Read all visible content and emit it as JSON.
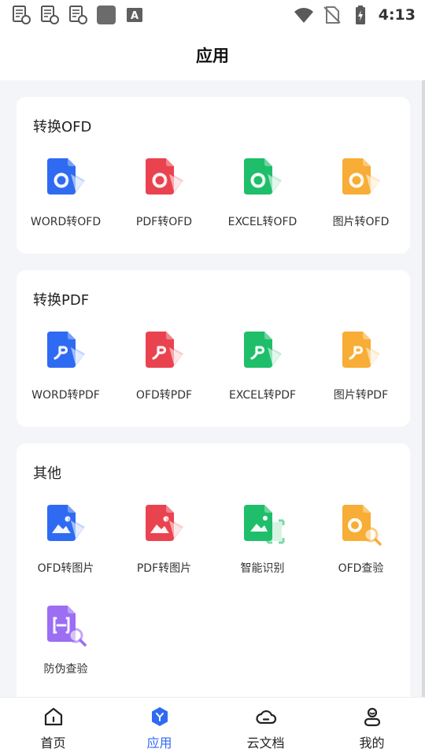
{
  "status_bar": {
    "time": "4:13",
    "badge_letter": "A"
  },
  "header": {
    "title": "应用"
  },
  "sections": [
    {
      "title": "转换OFD",
      "items": [
        {
          "label": "WORD转OFD",
          "glyph": "O",
          "color": "#2f6bf2",
          "icon": "word-to-ofd-icon"
        },
        {
          "label": "PDF转OFD",
          "glyph": "O",
          "color": "#ea4350",
          "icon": "pdf-to-ofd-icon"
        },
        {
          "label": "EXCEL转OFD",
          "glyph": "O",
          "color": "#1fbe6a",
          "icon": "excel-to-ofd-icon"
        },
        {
          "label": "图片转OFD",
          "glyph": "O",
          "color": "#f8ad36",
          "icon": "image-to-ofd-icon"
        }
      ]
    },
    {
      "title": "转换PDF",
      "items": [
        {
          "label": "WORD转PDF",
          "glyph": "pdf",
          "color": "#2f6bf2",
          "icon": "word-to-pdf-icon"
        },
        {
          "label": "OFD转PDF",
          "glyph": "pdf",
          "color": "#ea4350",
          "icon": "ofd-to-pdf-icon"
        },
        {
          "label": "EXCEL转PDF",
          "glyph": "pdf",
          "color": "#1fbe6a",
          "icon": "excel-to-pdf-icon"
        },
        {
          "label": "图片转PDF",
          "glyph": "pdf",
          "color": "#f8ad36",
          "icon": "image-to-pdf-icon"
        }
      ]
    },
    {
      "title": "其他",
      "items": [
        {
          "label": "OFD转图片",
          "glyph": "image",
          "color": "#2f6bf2",
          "icon": "ofd-to-image-icon"
        },
        {
          "label": "PDF转图片",
          "glyph": "image",
          "color": "#ea4350",
          "icon": "pdf-to-image-icon"
        },
        {
          "label": "智能识别",
          "glyph": "scan",
          "color": "#1fbe6a",
          "icon": "smart-recognition-icon"
        },
        {
          "label": "OFD查验",
          "glyph": "check",
          "color": "#f8ad36",
          "icon": "ofd-verify-icon"
        },
        {
          "label": "防伪查验",
          "glyph": "anticounterfeit",
          "color": "#9b6ef3",
          "icon": "anti-counterfeit-verify-icon"
        }
      ]
    }
  ],
  "bottom_nav": [
    {
      "label": "首页",
      "icon": "home-icon",
      "active": false
    },
    {
      "label": "应用",
      "icon": "apps-icon",
      "active": true
    },
    {
      "label": "云文档",
      "icon": "cloud-icon",
      "active": false
    },
    {
      "label": "我的",
      "icon": "profile-icon",
      "active": false
    }
  ],
  "colors": {
    "accent": "#2f6bf2",
    "inactive_nav": "#222222"
  }
}
